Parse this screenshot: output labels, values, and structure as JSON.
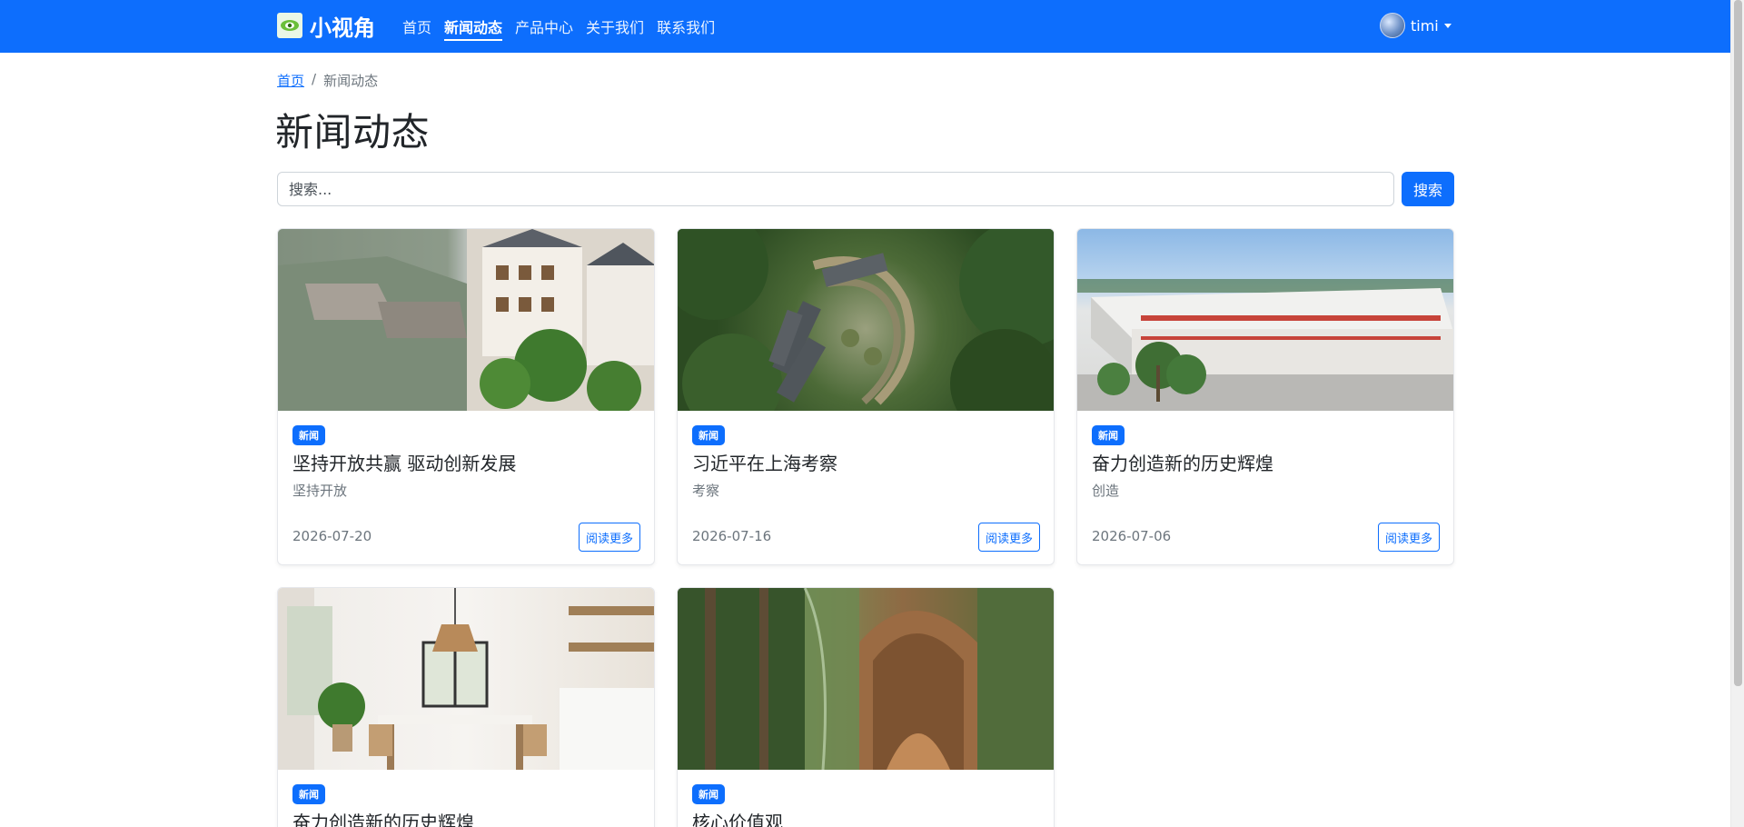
{
  "nav": {
    "brand": "小视角",
    "links": [
      {
        "label": "首页",
        "active": false
      },
      {
        "label": "新闻动态",
        "active": true
      },
      {
        "label": "产品中心",
        "active": false
      },
      {
        "label": "关于我们",
        "active": false
      },
      {
        "label": "联系我们",
        "active": false
      }
    ],
    "user": "timi"
  },
  "breadcrumb": {
    "home": "首页",
    "separator": "/",
    "current": "新闻动态"
  },
  "page_title": "新闻动态",
  "search": {
    "placeholder": "搜索...",
    "button": "搜索"
  },
  "cards": [
    {
      "badge": "新闻",
      "title": "坚持开放共赢 驱动创新发展",
      "subtitle": "坚持开放",
      "date": "2026-07-20",
      "button": "阅读更多",
      "image": "riverside-buildings"
    },
    {
      "badge": "新闻",
      "title": "习近平在上海考察",
      "subtitle": "考察",
      "date": "2026-07-16",
      "button": "阅读更多",
      "image": "aerial-forest-campus"
    },
    {
      "badge": "新闻",
      "title": "奋力创造新的历史辉煌",
      "subtitle": "创造",
      "date": "2026-07-06",
      "button": "阅读更多",
      "image": "factory-building"
    },
    {
      "badge": "新闻",
      "title": "奋力创造新的历史辉煌",
      "subtitle": "",
      "date": "",
      "button": "",
      "image": "dining-room-interior"
    },
    {
      "badge": "新闻",
      "title": "核心价值观",
      "subtitle": "",
      "date": "",
      "button": "",
      "image": "glass-library-forest"
    }
  ],
  "colors": {
    "primary": "#0d6efd",
    "muted": "#6c757d",
    "text": "#212529"
  }
}
